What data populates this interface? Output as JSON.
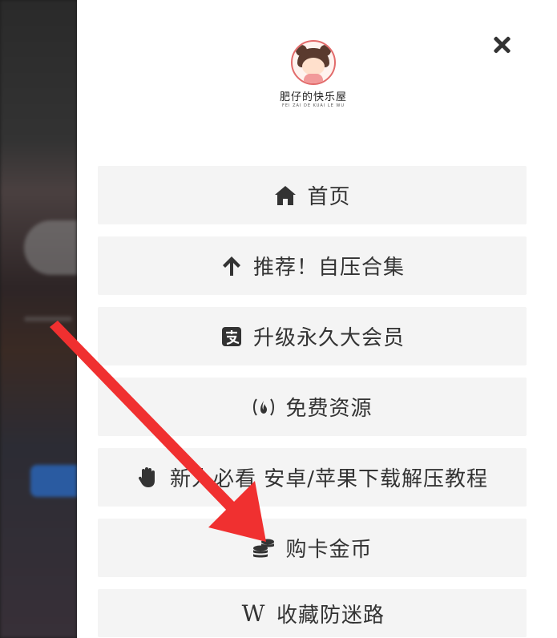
{
  "site": {
    "name": "肥仔的快乐屋",
    "subtitle": "FEI ZAI DE KUAI LE WU"
  },
  "menu": {
    "items": [
      {
        "label": "首页",
        "icon": "home-icon"
      },
      {
        "label": "推荐！自压合集",
        "icon": "arrow-up-icon"
      },
      {
        "label": "升级永久大会员",
        "icon": "alipay-icon"
      },
      {
        "label": "免费资源",
        "icon": "free-code-camp-icon"
      },
      {
        "label": "新人必看 安卓/苹果下载解压教程",
        "icon": "hand-icon"
      },
      {
        "label": "购卡金币",
        "icon": "coins-icon"
      },
      {
        "label": "收藏防迷路",
        "icon": "wikipedia-icon",
        "glyph": "W"
      }
    ]
  },
  "annotation": {
    "color": "#f03030",
    "target": "购卡金币"
  }
}
